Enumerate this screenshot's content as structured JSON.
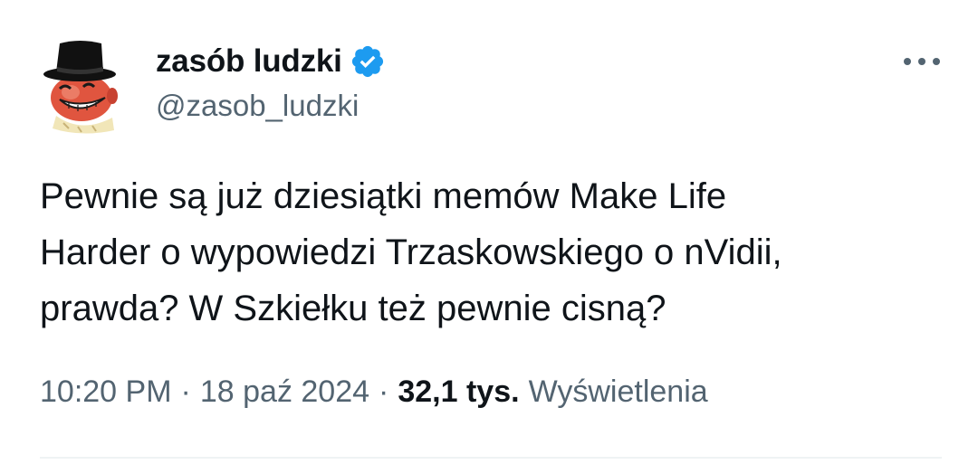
{
  "author": {
    "display_name": "zasób ludzki",
    "handle": "@zasob_ludzki",
    "verified": true,
    "avatar_icon": "top-hat-grinning-face-avatar"
  },
  "tweet": {
    "text": "Pewnie są już dziesiątki memów Make Life\nHarder o wypowiedzi Trzaskowskiego o nVidii,\nprawda? W Szkiełku też pewnie cisną?"
  },
  "meta": {
    "time": "10:20 PM",
    "separator": "·",
    "date": "18 paź 2024",
    "views_count": "32,1 tys.",
    "views_label": "Wyświetlenia"
  },
  "icons": {
    "verified": "verified-badge-icon",
    "more": "more-options-icon"
  },
  "colors": {
    "text_primary": "#0f1419",
    "text_secondary": "#536471",
    "verified_blue": "#1d9bf0",
    "divider": "#eff3f4"
  }
}
